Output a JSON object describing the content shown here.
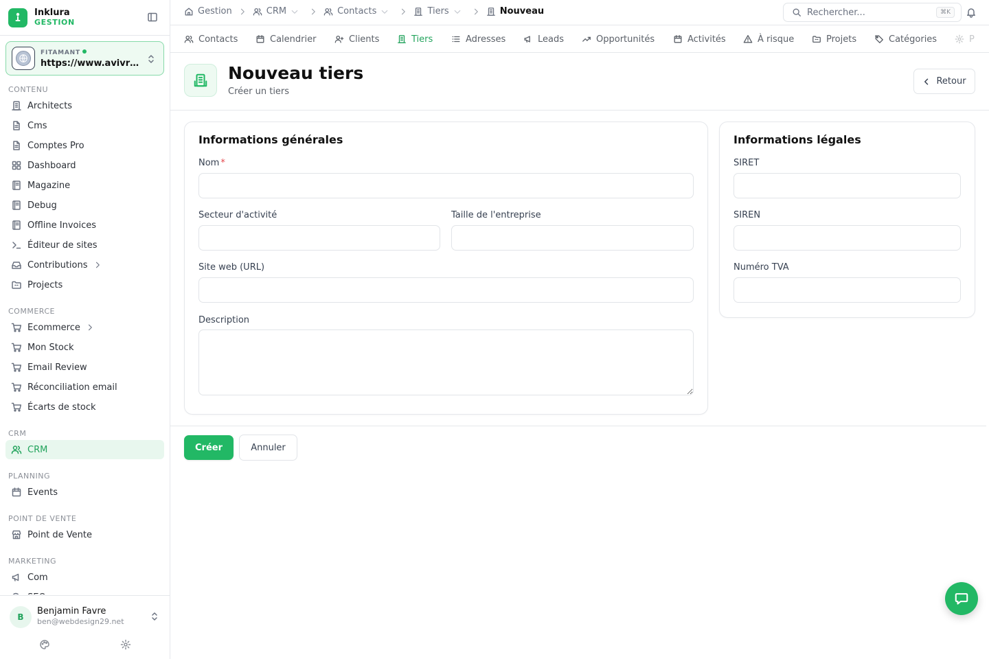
{
  "brand": {
    "name": "Inklura",
    "sub": "GESTION"
  },
  "site": {
    "label": "FITAMANT",
    "url": "https://www.avivre-immobilier.fr"
  },
  "sidebar": {
    "sections": [
      {
        "title": "CONTENU",
        "items": [
          {
            "label": "Architects",
            "icon": "building-icon"
          },
          {
            "label": "Cms",
            "icon": "file-icon"
          },
          {
            "label": "Comptes Pro",
            "icon": "file-icon"
          },
          {
            "label": "Dashboard",
            "icon": "grid-icon"
          },
          {
            "label": "Magazine",
            "icon": "book-icon"
          },
          {
            "label": "Debug",
            "icon": "book-icon"
          },
          {
            "label": "Offline Invoices",
            "icon": "book-icon"
          },
          {
            "label": "Éditeur de sites",
            "icon": "terminal-icon"
          },
          {
            "label": "Contributions",
            "icon": "inbox-icon",
            "chevron": true
          },
          {
            "label": "Projects",
            "icon": "folder-icon"
          }
        ]
      },
      {
        "title": "COMMERCE",
        "items": [
          {
            "label": "Ecommerce",
            "icon": "cart-icon",
            "chevron": true
          },
          {
            "label": "Mon Stock",
            "icon": "cart-icon"
          },
          {
            "label": "Email Review",
            "icon": "cart-icon"
          },
          {
            "label": "Réconciliation email",
            "icon": "cart-icon"
          },
          {
            "label": "Écarts de stock",
            "icon": "cart-icon"
          }
        ]
      },
      {
        "title": "CRM",
        "items": [
          {
            "label": "CRM",
            "icon": "users-icon",
            "active": true
          }
        ]
      },
      {
        "title": "PLANNING",
        "items": [
          {
            "label": "Events",
            "icon": "calendar-icon"
          }
        ]
      },
      {
        "title": "POINT DE VENTE",
        "items": [
          {
            "label": "Point de Vente",
            "icon": "store-icon"
          }
        ]
      },
      {
        "title": "MARKETING",
        "items": [
          {
            "label": "Com",
            "icon": "megaphone-icon"
          },
          {
            "label": "SEO",
            "icon": "search-icon"
          }
        ]
      }
    ]
  },
  "user": {
    "initial": "B",
    "name": "Benjamin Favre",
    "email": "ben@webdesign29.net"
  },
  "breadcrumb": [
    {
      "label": "Gestion",
      "icon": "home-icon"
    },
    {
      "label": "CRM",
      "icon": "users-icon",
      "dropdown": true
    },
    {
      "label": "Contacts",
      "icon": "users-icon",
      "dropdown": true
    },
    {
      "label": "Tiers",
      "icon": "building-icon",
      "dropdown": true
    },
    {
      "label": "Nouveau",
      "icon": "building-icon",
      "current": true
    }
  ],
  "search": {
    "placeholder": "Rechercher...",
    "shortcut": "⌘K"
  },
  "tabs": [
    {
      "label": "Contacts",
      "icon": "users-icon"
    },
    {
      "label": "Calendrier",
      "icon": "calendar-icon"
    },
    {
      "label": "Clients",
      "icon": "user-plus-icon"
    },
    {
      "label": "Tiers",
      "icon": "building-icon",
      "active": true
    },
    {
      "label": "Adresses",
      "icon": "list-icon"
    },
    {
      "label": "Leads",
      "icon": "megaphone-icon"
    },
    {
      "label": "Opportunités",
      "icon": "trend-up-icon"
    },
    {
      "label": "Activités",
      "icon": "calendar-icon"
    },
    {
      "label": "À risque",
      "icon": "warning-icon"
    },
    {
      "label": "Projets",
      "icon": "folder-icon"
    },
    {
      "label": "Catégories",
      "icon": "tag-icon"
    },
    {
      "label": "P",
      "icon": "gear-icon",
      "faded": true
    }
  ],
  "page": {
    "title": "Nouveau tiers",
    "subtitle": "Créer un tiers",
    "back_label": "Retour"
  },
  "general": {
    "title": "Informations générales",
    "nom_label": "Nom",
    "nom_required": "*",
    "nom_value": "",
    "secteur_label": "Secteur d'activité",
    "secteur_value": "",
    "taille_label": "Taille de l'entreprise",
    "taille_value": "",
    "site_label": "Site web (URL)",
    "site_value": "",
    "description_label": "Description",
    "description_value": ""
  },
  "legal": {
    "title": "Informations légales",
    "siret_label": "SIRET",
    "siret_value": "",
    "siren_label": "SIREN",
    "siren_value": "",
    "tva_label": "Numéro TVA",
    "tva_value": ""
  },
  "actions": {
    "create_label": "Créer",
    "cancel_label": "Annuler"
  },
  "colors": {
    "accent": "#22b865",
    "active_bg": "#e8f7ee",
    "required": "#e5484d"
  }
}
